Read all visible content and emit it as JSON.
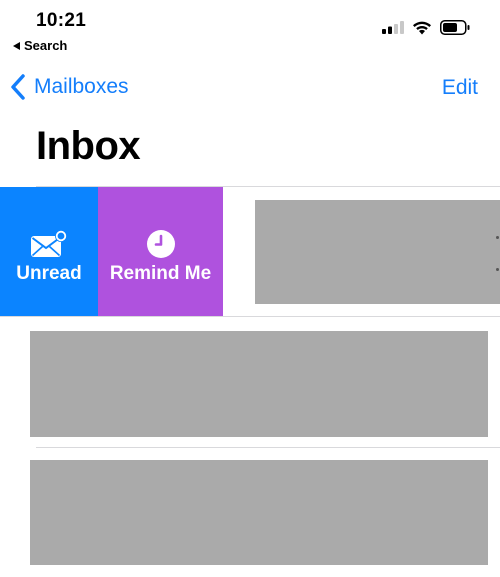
{
  "status_bar": {
    "time": "10:21",
    "back_app_label": "Search",
    "icons": [
      "cellular-signal-icon",
      "wifi-icon",
      "battery-icon"
    ]
  },
  "nav": {
    "back_label": "Mailboxes",
    "edit_label": "Edit"
  },
  "title": "Inbox",
  "swipe_actions": [
    {
      "name": "unread",
      "label": "Unread",
      "icon": "envelope-badge-icon",
      "color": "#0b84ff"
    },
    {
      "name": "remind",
      "label": "Remind Me",
      "icon": "clock-icon",
      "color": "#af52de"
    }
  ],
  "colors": {
    "accent": "#147efb",
    "redaction": "#aaaaaa"
  }
}
